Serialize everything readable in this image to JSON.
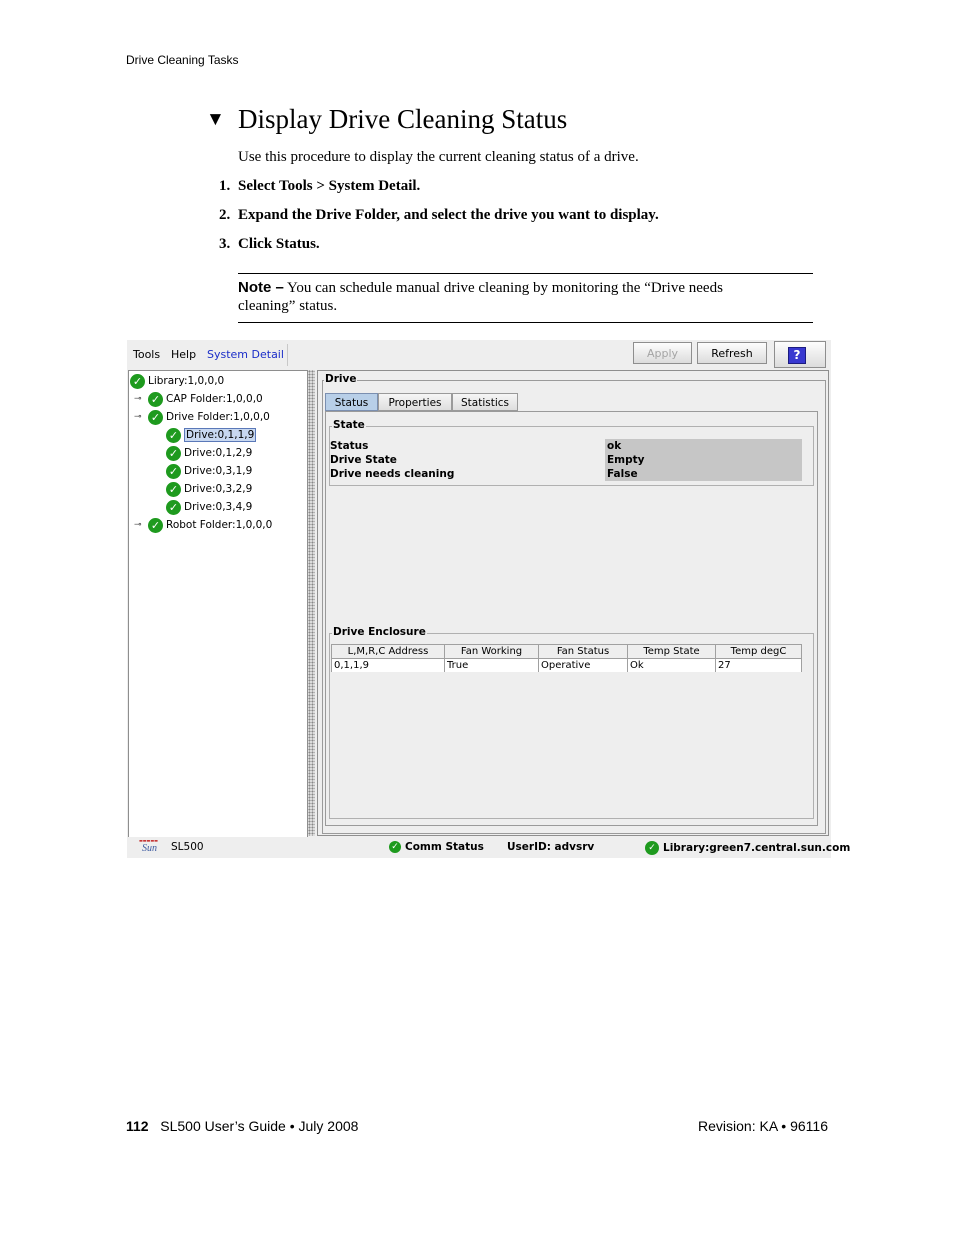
{
  "running_header": "Drive Cleaning Tasks",
  "title_marker": "▼",
  "title": "Display Drive Cleaning Status",
  "intro": "Use this procedure to display the current cleaning status of a drive.",
  "steps": [
    {
      "num": "1.",
      "text": "Select Tools > System Detail."
    },
    {
      "num": "2.",
      "text": "Expand the Drive Folder, and select the drive you want to display."
    },
    {
      "num": "3.",
      "text": "Click Status."
    }
  ],
  "note": {
    "label": "Note –",
    "line1": "You can schedule manual drive cleaning by monitoring the “Drive needs",
    "line2": "cleaning” status."
  },
  "screenshot": {
    "menu": {
      "tools": "Tools",
      "help": "Help",
      "system_detail": "System Detail"
    },
    "toolbar": {
      "apply": "Apply",
      "refresh": "Refresh",
      "help_icon": "?"
    },
    "tree": [
      {
        "label": "Library:1,0,0,0"
      },
      {
        "label": "CAP Folder:1,0,0,0"
      },
      {
        "label": "Drive Folder:1,0,0,0"
      },
      {
        "label": "Drive:0,1,1,9"
      },
      {
        "label": "Drive:0,1,2,9"
      },
      {
        "label": "Drive:0,3,1,9"
      },
      {
        "label": "Drive:0,3,2,9"
      },
      {
        "label": "Drive:0,3,4,9"
      },
      {
        "label": "Robot Folder:1,0,0,0"
      }
    ],
    "drive_group": "Drive",
    "tabs": [
      "Status",
      "Properties",
      "Statistics"
    ],
    "state_group": "State",
    "state_rows": [
      {
        "label": "Status",
        "value": "ok"
      },
      {
        "label": "Drive State",
        "value": "Empty"
      },
      {
        "label": "Drive needs cleaning",
        "value": "False"
      }
    ],
    "enclosure_group": "Drive Enclosure",
    "enclosure_columns": [
      "L,M,R,C Address",
      "Fan Working",
      "Fan Status",
      "Temp State",
      "Temp degC"
    ],
    "enclosure_row": [
      "0,1,1,9",
      "True",
      "Operative",
      "Ok",
      "27"
    ],
    "statusbar": {
      "logo_text": "Sun",
      "product": "SL500",
      "comm_status": "Comm Status",
      "user": "UserID: advsrv",
      "library": "Library:green7.central.sun.com"
    },
    "colors": {
      "ok_green": "#1e9a1e",
      "selected_tab": "#b8cfe8",
      "menu_active": "#1a2dc8"
    }
  },
  "footer": {
    "page": "112",
    "guide": "SL500 User’s Guide",
    "bullet": "•",
    "date": "July 2008",
    "revision": "Revision: KA",
    "doc_num": "96116"
  }
}
